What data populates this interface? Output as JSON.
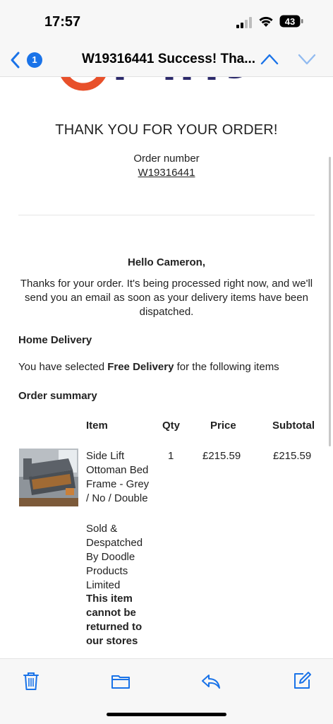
{
  "status": {
    "time": "17:57",
    "battery": "43"
  },
  "nav": {
    "unread_count": "1",
    "subject": "W19316441 Success! Tha..."
  },
  "email": {
    "logo_text": "Range",
    "heading": "THANK YOU FOR YOUR ORDER!",
    "order_label": "Order number",
    "order_number": "W19316441",
    "greeting": "Hello Cameron,",
    "thanks": "Thanks for your order. It's being processed right now, and we'll send you an email as soon as your delivery items have been dispatched.",
    "delivery_title": "Home Delivery",
    "delivery_pre": "You have selected ",
    "delivery_bold": "Free Delivery",
    "delivery_post": " for the following items",
    "summary_title": "Order summary",
    "table": {
      "headers": {
        "item": "Item",
        "qty": "Qty",
        "price": "Price",
        "subtotal": "Subtotal"
      },
      "row": {
        "name": "Side Lift Ottoman Bed Frame - Grey / No / Double",
        "seller": "Sold & Despatched By Doodle Products Limited",
        "notice": "This item cannot be returned to our stores",
        "qty": "1",
        "price": "£215.59",
        "subtotal": "£215.59"
      }
    }
  },
  "colors": {
    "accent": "#1a73e8",
    "brand_orange": "#e8502a",
    "brand_navy": "#2c2a6b"
  },
  "toolbar": {
    "icons": [
      "trash-icon",
      "folder-icon",
      "reply-icon",
      "compose-icon"
    ]
  }
}
